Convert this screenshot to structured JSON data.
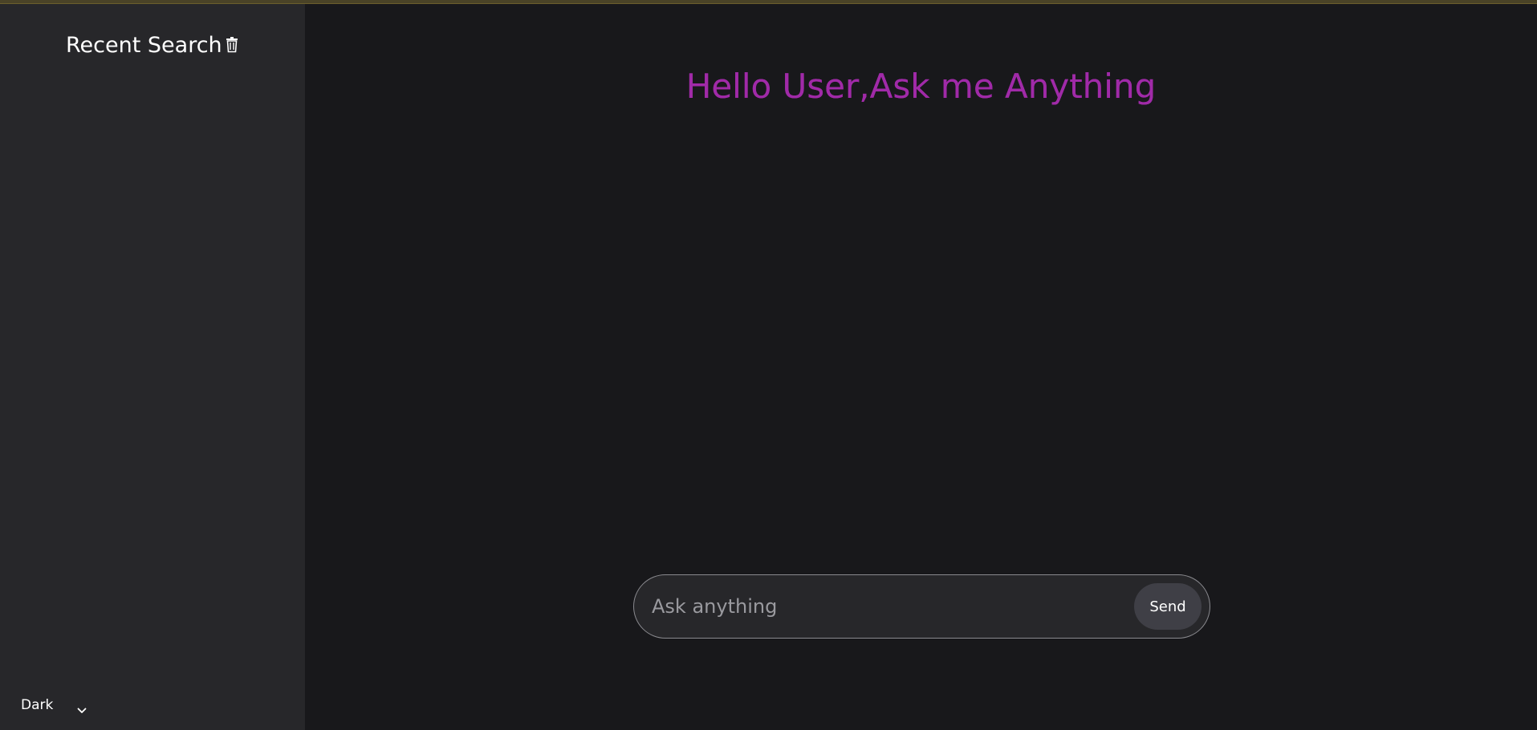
{
  "sidebar": {
    "title": "Recent Search",
    "clear_icon": "trash-icon",
    "theme": {
      "selected": "Dark",
      "icon": "chevron-down-icon"
    }
  },
  "main": {
    "greeting": "Hello User,Ask me Anything",
    "input": {
      "placeholder": "Ask anything",
      "value": ""
    },
    "send_label": "Send"
  },
  "colors": {
    "accent_start": "#a0248a",
    "accent_end": "#9d2fc4",
    "sidebar_bg": "#27272a",
    "main_bg": "#18181b"
  }
}
